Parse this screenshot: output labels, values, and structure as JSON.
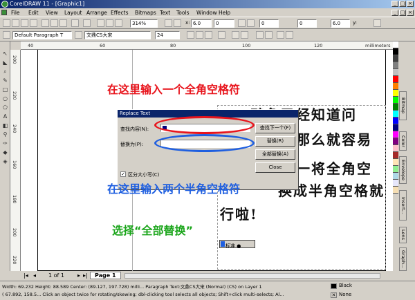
{
  "window": {
    "title": "CorelDRAW 11 - [Graphic1]"
  },
  "menu": [
    "File",
    "Edit",
    "View",
    "Layout",
    "Arrange",
    "Effects",
    "Bitmaps",
    "Text",
    "Tools",
    "Window",
    "Help"
  ],
  "toolbar": {
    "zoom": "314%",
    "style": "Default Paragraph T",
    "font": "文鼎CS大宋",
    "size": "24",
    "angle": "0",
    "num1": "0",
    "num2": "0",
    "pos_x": "6.0",
    "pos_y": "6.0",
    "x_label": "x:",
    "y_label": "y:"
  },
  "rulers": {
    "h_ticks": [
      "40",
      "60",
      "80",
      "100",
      "120"
    ],
    "unit": "millimeters",
    "v_ticks": [
      "200",
      "220",
      "240",
      "160",
      "180",
      "200",
      "220"
    ]
  },
  "page_nav": {
    "position": "1 of 1",
    "tab": "Page 1"
  },
  "document": {
    "lines": [
      "鸭鱼已经知道问",
      "那么就容易",
      "一将全角空",
      "换成半角空格就",
      "行啦!"
    ],
    "ime": "标准"
  },
  "dialog": {
    "title": "Replace Text",
    "find_label": "查找内容(N):",
    "replace_label": "替换为(P):",
    "case_label": "区分大小写(C)",
    "case_checked": true,
    "buttons": [
      "查找下一个(F)",
      "替换(R)",
      "全部替换(A)",
      "Close"
    ]
  },
  "annotations": {
    "a1": "在这里输入一个全角空格符",
    "a2": "在这里输入两个半角空格符",
    "a3": "选择“全部替换”"
  },
  "dockers": [
    "Bitmap",
    "Color",
    "Envelope",
    "Insert...",
    "Lens",
    "Graph..."
  ],
  "status": {
    "line1": "Width: 69.232  Height: 88.589  Center: (89.127, 197.728)  milli...  Paragraph Text:文鼎CS大宋 (Normal) (CS) on Layer 1",
    "line2": "( 67.892, 158.5...  Click an object twice for rotating/skewing; dbl-clicking tool selects all objects; Shift+click multi-selects; Al...",
    "fill": "Black",
    "outline": "None"
  },
  "colors": {
    "red": "#e8141c",
    "blue": "#1f5fe0",
    "green": "#1aa51a"
  }
}
